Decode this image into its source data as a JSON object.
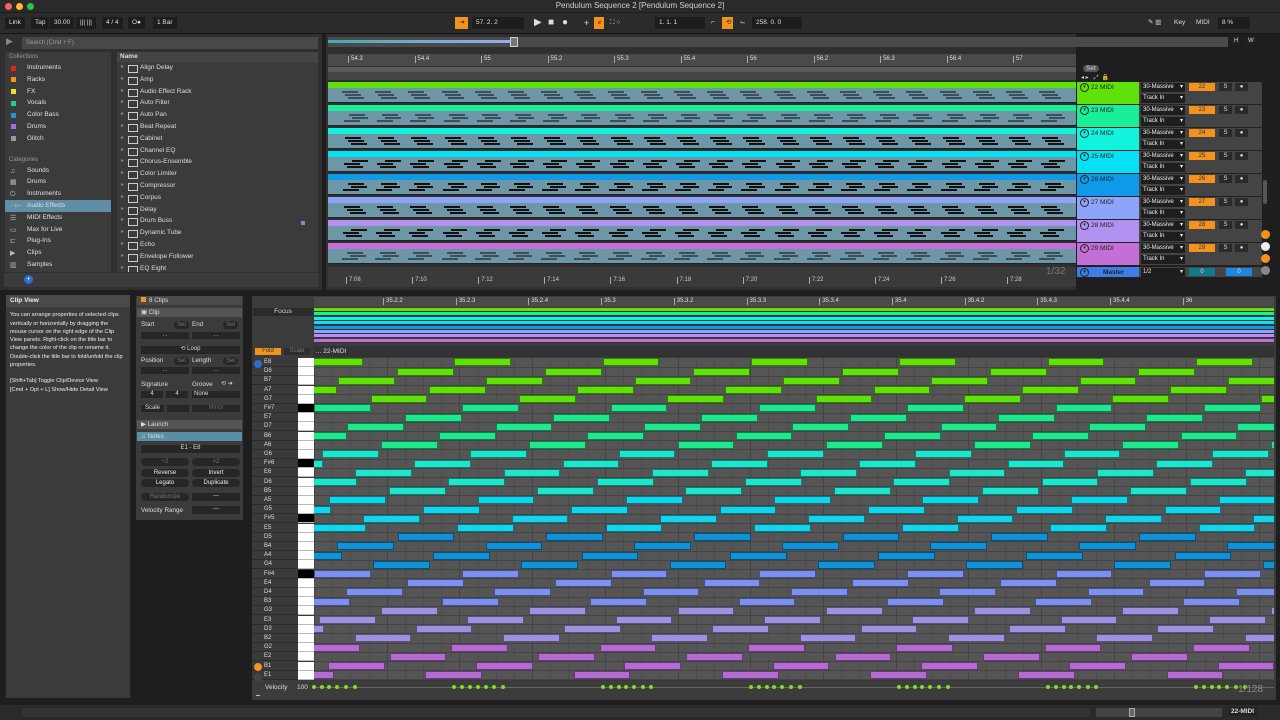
{
  "window": {
    "title": "Pendulum Sequence 2  [Pendulum Sequence 2]",
    "traffic_lights": [
      "#fe5f57",
      "#febc2e",
      "#28c840"
    ]
  },
  "control_bar": {
    "link": "Link",
    "tap": "Tap",
    "tempo": "30.00",
    "signature": "4 / 4",
    "metronome": "O●",
    "quantize": "1 Bar",
    "position": "57.  2.  2",
    "loop_start": "1.  1.  1",
    "loop_length": "258.  0.  0",
    "key": "Key",
    "midi": "MIDI",
    "cpu": "8 %"
  },
  "browser": {
    "search_placeholder": "Search (Cmd + F)",
    "collections_title": "Collections",
    "collections": [
      {
        "label": "Instruments",
        "color": "#e82020"
      },
      {
        "label": "Racks",
        "color": "#f4921e"
      },
      {
        "label": "FX",
        "color": "#f0e020"
      },
      {
        "label": "Vocals",
        "color": "#20d080"
      },
      {
        "label": "Color Bass",
        "color": "#2090e0"
      },
      {
        "label": "Drums",
        "color": "#a070e0"
      },
      {
        "label": "Glitch",
        "color": "#999999"
      }
    ],
    "categories_title": "Categories",
    "categories": [
      {
        "label": "Sounds",
        "icon": "♫"
      },
      {
        "label": "Drums",
        "icon": "▦"
      },
      {
        "label": "Instruments",
        "icon": "⏻"
      },
      {
        "label": "Audio Effects",
        "icon": "⊣⊢",
        "selected": true
      },
      {
        "label": "MIDI Effects",
        "icon": "☰"
      },
      {
        "label": "Max for Live",
        "icon": "▭"
      },
      {
        "label": "Plug-Ins",
        "icon": "⊏"
      },
      {
        "label": "Clips",
        "icon": "▶"
      },
      {
        "label": "Samples",
        "icon": "▥"
      }
    ],
    "name_header": "Name",
    "items": [
      "Align Delay",
      "Amp",
      "Audio Effect Rack",
      "Auto Filter",
      "Auto Pan",
      "Beat Repeat",
      "Cabinet",
      "Channel EQ",
      "Chorus-Ensemble",
      "Color Limiter",
      "Compressor",
      "Corpus",
      "Delay",
      "Drum Buss",
      "Dynamic Tube",
      "Echo",
      "Envelope Follower",
      "EQ Eight"
    ]
  },
  "arrangement": {
    "bar_ruler": [
      "54.3",
      "54.4",
      "55",
      "55.2",
      "55.3",
      "55.4",
      "56",
      "56.2",
      "56.3",
      "56.4",
      "57"
    ],
    "time_ruler": [
      "7:08",
      "7:10",
      "7:12",
      "7:14",
      "7:16",
      "7:18",
      "7:20",
      "7:22",
      "7:24",
      "7:26",
      "7:28"
    ],
    "zoom_readout": "1/32",
    "set_label": "Set",
    "h_btn": "H",
    "w_btn": "W",
    "tracks": [
      {
        "name": "22 MIDI",
        "device": "30-Massive",
        "input": "Track In",
        "number": "22",
        "solo": "S",
        "color": "#5ee20a"
      },
      {
        "name": "23 MIDI",
        "device": "30-Massive",
        "input": "Track In",
        "number": "23",
        "solo": "S",
        "color": "#19ee98"
      },
      {
        "name": "24 MIDI",
        "device": "30-Massive",
        "input": "Track In",
        "number": "24",
        "solo": "S",
        "color": "#12f2dc"
      },
      {
        "name": "25 MIDI",
        "device": "30-Massive",
        "input": "Track In",
        "number": "25",
        "solo": "S",
        "color": "#06e2f4"
      },
      {
        "name": "26 MIDI",
        "device": "30-Massive",
        "input": "Track In",
        "number": "26",
        "solo": "S",
        "color": "#0e9ae8"
      },
      {
        "name": "27 MIDI",
        "device": "30-Massive",
        "input": "Track In",
        "number": "27",
        "solo": "S",
        "color": "#8ea4fa"
      },
      {
        "name": "28 MIDI",
        "device": "30-Massive",
        "input": "Track In",
        "number": "28",
        "solo": "S",
        "color": "#b192f0"
      },
      {
        "name": "29 MIDI",
        "device": "30-Massive",
        "input": "Track In",
        "number": "29",
        "solo": "S",
        "color": "#c36fd8"
      }
    ],
    "master": {
      "name": "Master",
      "routing": "1/2",
      "vol_a": "0",
      "vol_b": "0",
      "color": "#3d7ee8"
    }
  },
  "clip_view_help": {
    "title": "Clip View",
    "body": "You can arrange properties of selected clips vertically or horizontally by dragging the mouse cursor on the right edge of the Clip View panels. Right-click on the title bar to change the color of the clip or rename it. Double-click the title bar to fold/unfold the clip properties.",
    "shortcut1": "[Shift+Tab] Toggle Clip/Device View",
    "shortcut2": "[Cmd + Opt + L] Show/Hide Detail View"
  },
  "clip_panel": {
    "header": "8 Clips",
    "clip": "Clip",
    "start": "Start",
    "end": "End",
    "set": "Set",
    "loop": "Loop",
    "position": "Position",
    "length": "Length",
    "signature": "Signature",
    "groove": "Groove",
    "sig_num": "4",
    "sig_den": "4",
    "groove_value": "None",
    "scale": "Scale",
    "scale_mode": "Minor",
    "launch": "Launch",
    "notes": "Notes",
    "range": "E1 - E8",
    "half": "÷2",
    "double": "×2",
    "reverse": "Reverse",
    "invert": "Invert",
    "legato": "Legato",
    "duplicate": "Duplicate",
    "randomize": "Randomize",
    "dashes": "---",
    "velocity_range": "Velocity Range"
  },
  "piano_roll": {
    "ruler": [
      "35.2.2",
      "35.2.3",
      "35.2.4",
      "35.3",
      "35.3.2",
      "35.3.3",
      "35.3.4",
      "35.4",
      "35.4.2",
      "35.4.3",
      "35.4.4",
      "36"
    ],
    "focus": "Focus",
    "fold": "Fold",
    "scale": "Scale",
    "clip_name": "... 22-MIDI",
    "velocity_label": "Velocity",
    "velocity_value": "100",
    "zoom_readout": "1/128",
    "note_period_16ths": 2.04,
    "note_length_16ths": 0.78,
    "rows": [
      {
        "pitch": "E8",
        "black": false,
        "start": 1.93,
        "color": "#5ee20a"
      },
      {
        "pitch": "D8",
        "black": false,
        "start": 1.14,
        "color": "#5ee20a"
      },
      {
        "pitch": "B7",
        "black": false,
        "start": 0.33,
        "color": "#5ee20a"
      },
      {
        "pitch": "A7",
        "black": false,
        "start": 1.58,
        "color": "#5ee20a"
      },
      {
        "pitch": "G7",
        "black": false,
        "start": 0.78,
        "color": "#5ee20a"
      },
      {
        "pitch": "F#7",
        "black": true,
        "start": 0.0,
        "color": "#1ee88e"
      },
      {
        "pitch": "E7",
        "black": false,
        "start": 1.25,
        "color": "#1ee88e"
      },
      {
        "pitch": "D7",
        "black": false,
        "start": 0.46,
        "color": "#1ee88e"
      },
      {
        "pitch": "B6",
        "black": false,
        "start": 1.72,
        "color": "#1ee88e"
      },
      {
        "pitch": "A6",
        "black": false,
        "start": 0.92,
        "color": "#1ee88e"
      },
      {
        "pitch": "G6",
        "black": false,
        "start": 0.11,
        "color": "#1ee6cc"
      },
      {
        "pitch": "F#6",
        "black": true,
        "start": 1.38,
        "color": "#1ee6cc"
      },
      {
        "pitch": "E6",
        "black": false,
        "start": 0.57,
        "color": "#1ee6cc"
      },
      {
        "pitch": "D6",
        "black": false,
        "start": 1.85,
        "color": "#1ee6cc"
      },
      {
        "pitch": "B5",
        "black": false,
        "start": 1.03,
        "color": "#1ee6cc"
      },
      {
        "pitch": "A5",
        "black": false,
        "start": 0.21,
        "color": "#14d4ea"
      },
      {
        "pitch": "G5",
        "black": false,
        "start": 1.5,
        "color": "#14d4ea"
      },
      {
        "pitch": "F#5",
        "black": true,
        "start": 0.68,
        "color": "#14d4ea"
      },
      {
        "pitch": "E5",
        "black": false,
        "start": 1.97,
        "color": "#14d4ea"
      },
      {
        "pitch": "D5",
        "black": false,
        "start": 1.15,
        "color": "#1092d8"
      },
      {
        "pitch": "B4",
        "black": false,
        "start": 0.32,
        "color": "#1092d8"
      },
      {
        "pitch": "A4",
        "black": false,
        "start": 1.64,
        "color": "#1092d8"
      },
      {
        "pitch": "G4",
        "black": false,
        "start": 0.81,
        "color": "#1092d8"
      },
      {
        "pitch": "F#4",
        "black": true,
        "start": 0.0,
        "color": "#7d90f0"
      },
      {
        "pitch": "E4",
        "black": false,
        "start": 1.28,
        "color": "#7d90f0"
      },
      {
        "pitch": "D4",
        "black": false,
        "start": 0.44,
        "color": "#7d90f0"
      },
      {
        "pitch": "B3",
        "black": false,
        "start": 1.76,
        "color": "#7d90f0"
      },
      {
        "pitch": "G3",
        "black": false,
        "start": 0.92,
        "color": "#a190e0"
      },
      {
        "pitch": "E3",
        "black": false,
        "start": 0.07,
        "color": "#a190e0"
      },
      {
        "pitch": "D3",
        "black": false,
        "start": 1.4,
        "color": "#a190e0"
      },
      {
        "pitch": "B2",
        "black": false,
        "start": 0.56,
        "color": "#a190e0"
      },
      {
        "pitch": "G2",
        "black": false,
        "start": 1.89,
        "color": "#b56cd2"
      },
      {
        "pitch": "E2",
        "black": false,
        "start": 1.04,
        "color": "#b56cd2"
      },
      {
        "pitch": "B1",
        "black": false,
        "start": 0.19,
        "color": "#b56cd2"
      },
      {
        "pitch": "E1",
        "black": false,
        "start": 1.53,
        "color": "#b56cd2"
      }
    ]
  },
  "status_bar": {
    "track": "22-MIDI"
  }
}
